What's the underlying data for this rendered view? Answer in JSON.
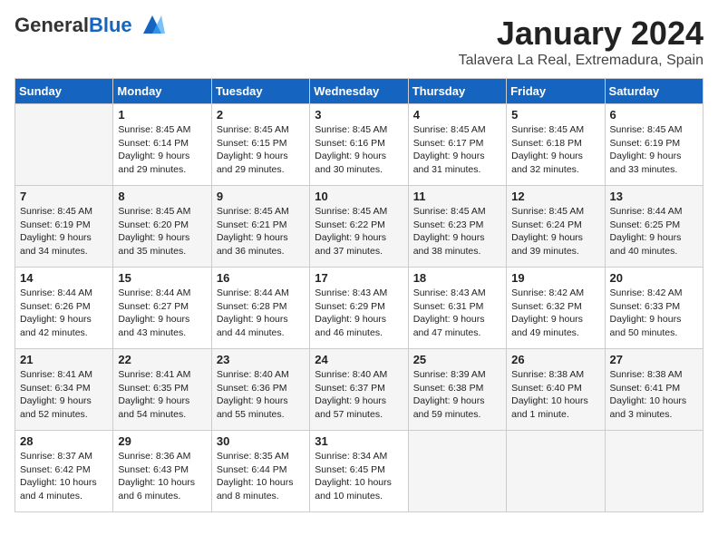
{
  "header": {
    "logo_general": "General",
    "logo_blue": "Blue",
    "month": "January 2024",
    "location": "Talavera La Real, Extremadura, Spain"
  },
  "days_of_week": [
    "Sunday",
    "Monday",
    "Tuesday",
    "Wednesday",
    "Thursday",
    "Friday",
    "Saturday"
  ],
  "weeks": [
    [
      {
        "day": null
      },
      {
        "day": "1",
        "sunrise": "Sunrise: 8:45 AM",
        "sunset": "Sunset: 6:14 PM",
        "daylight": "Daylight: 9 hours and 29 minutes."
      },
      {
        "day": "2",
        "sunrise": "Sunrise: 8:45 AM",
        "sunset": "Sunset: 6:15 PM",
        "daylight": "Daylight: 9 hours and 29 minutes."
      },
      {
        "day": "3",
        "sunrise": "Sunrise: 8:45 AM",
        "sunset": "Sunset: 6:16 PM",
        "daylight": "Daylight: 9 hours and 30 minutes."
      },
      {
        "day": "4",
        "sunrise": "Sunrise: 8:45 AM",
        "sunset": "Sunset: 6:17 PM",
        "daylight": "Daylight: 9 hours and 31 minutes."
      },
      {
        "day": "5",
        "sunrise": "Sunrise: 8:45 AM",
        "sunset": "Sunset: 6:18 PM",
        "daylight": "Daylight: 9 hours and 32 minutes."
      },
      {
        "day": "6",
        "sunrise": "Sunrise: 8:45 AM",
        "sunset": "Sunset: 6:19 PM",
        "daylight": "Daylight: 9 hours and 33 minutes."
      }
    ],
    [
      {
        "day": "7",
        "sunrise": "Sunrise: 8:45 AM",
        "sunset": "Sunset: 6:19 PM",
        "daylight": "Daylight: 9 hours and 34 minutes."
      },
      {
        "day": "8",
        "sunrise": "Sunrise: 8:45 AM",
        "sunset": "Sunset: 6:20 PM",
        "daylight": "Daylight: 9 hours and 35 minutes."
      },
      {
        "day": "9",
        "sunrise": "Sunrise: 8:45 AM",
        "sunset": "Sunset: 6:21 PM",
        "daylight": "Daylight: 9 hours and 36 minutes."
      },
      {
        "day": "10",
        "sunrise": "Sunrise: 8:45 AM",
        "sunset": "Sunset: 6:22 PM",
        "daylight": "Daylight: 9 hours and 37 minutes."
      },
      {
        "day": "11",
        "sunrise": "Sunrise: 8:45 AM",
        "sunset": "Sunset: 6:23 PM",
        "daylight": "Daylight: 9 hours and 38 minutes."
      },
      {
        "day": "12",
        "sunrise": "Sunrise: 8:45 AM",
        "sunset": "Sunset: 6:24 PM",
        "daylight": "Daylight: 9 hours and 39 minutes."
      },
      {
        "day": "13",
        "sunrise": "Sunrise: 8:44 AM",
        "sunset": "Sunset: 6:25 PM",
        "daylight": "Daylight: 9 hours and 40 minutes."
      }
    ],
    [
      {
        "day": "14",
        "sunrise": "Sunrise: 8:44 AM",
        "sunset": "Sunset: 6:26 PM",
        "daylight": "Daylight: 9 hours and 42 minutes."
      },
      {
        "day": "15",
        "sunrise": "Sunrise: 8:44 AM",
        "sunset": "Sunset: 6:27 PM",
        "daylight": "Daylight: 9 hours and 43 minutes."
      },
      {
        "day": "16",
        "sunrise": "Sunrise: 8:44 AM",
        "sunset": "Sunset: 6:28 PM",
        "daylight": "Daylight: 9 hours and 44 minutes."
      },
      {
        "day": "17",
        "sunrise": "Sunrise: 8:43 AM",
        "sunset": "Sunset: 6:29 PM",
        "daylight": "Daylight: 9 hours and 46 minutes."
      },
      {
        "day": "18",
        "sunrise": "Sunrise: 8:43 AM",
        "sunset": "Sunset: 6:31 PM",
        "daylight": "Daylight: 9 hours and 47 minutes."
      },
      {
        "day": "19",
        "sunrise": "Sunrise: 8:42 AM",
        "sunset": "Sunset: 6:32 PM",
        "daylight": "Daylight: 9 hours and 49 minutes."
      },
      {
        "day": "20",
        "sunrise": "Sunrise: 8:42 AM",
        "sunset": "Sunset: 6:33 PM",
        "daylight": "Daylight: 9 hours and 50 minutes."
      }
    ],
    [
      {
        "day": "21",
        "sunrise": "Sunrise: 8:41 AM",
        "sunset": "Sunset: 6:34 PM",
        "daylight": "Daylight: 9 hours and 52 minutes."
      },
      {
        "day": "22",
        "sunrise": "Sunrise: 8:41 AM",
        "sunset": "Sunset: 6:35 PM",
        "daylight": "Daylight: 9 hours and 54 minutes."
      },
      {
        "day": "23",
        "sunrise": "Sunrise: 8:40 AM",
        "sunset": "Sunset: 6:36 PM",
        "daylight": "Daylight: 9 hours and 55 minutes."
      },
      {
        "day": "24",
        "sunrise": "Sunrise: 8:40 AM",
        "sunset": "Sunset: 6:37 PM",
        "daylight": "Daylight: 9 hours and 57 minutes."
      },
      {
        "day": "25",
        "sunrise": "Sunrise: 8:39 AM",
        "sunset": "Sunset: 6:38 PM",
        "daylight": "Daylight: 9 hours and 59 minutes."
      },
      {
        "day": "26",
        "sunrise": "Sunrise: 8:38 AM",
        "sunset": "Sunset: 6:40 PM",
        "daylight": "Daylight: 10 hours and 1 minute."
      },
      {
        "day": "27",
        "sunrise": "Sunrise: 8:38 AM",
        "sunset": "Sunset: 6:41 PM",
        "daylight": "Daylight: 10 hours and 3 minutes."
      }
    ],
    [
      {
        "day": "28",
        "sunrise": "Sunrise: 8:37 AM",
        "sunset": "Sunset: 6:42 PM",
        "daylight": "Daylight: 10 hours and 4 minutes."
      },
      {
        "day": "29",
        "sunrise": "Sunrise: 8:36 AM",
        "sunset": "Sunset: 6:43 PM",
        "daylight": "Daylight: 10 hours and 6 minutes."
      },
      {
        "day": "30",
        "sunrise": "Sunrise: 8:35 AM",
        "sunset": "Sunset: 6:44 PM",
        "daylight": "Daylight: 10 hours and 8 minutes."
      },
      {
        "day": "31",
        "sunrise": "Sunrise: 8:34 AM",
        "sunset": "Sunset: 6:45 PM",
        "daylight": "Daylight: 10 hours and 10 minutes."
      },
      {
        "day": null
      },
      {
        "day": null
      },
      {
        "day": null
      }
    ]
  ]
}
